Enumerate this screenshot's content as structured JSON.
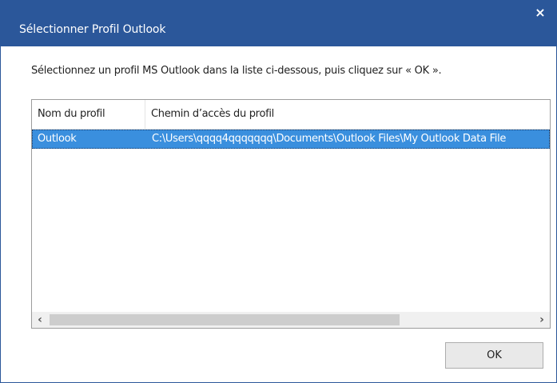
{
  "window": {
    "title": "Sélectionner Profil Outlook",
    "close_symbol": "×",
    "accent_color": "#2b579a"
  },
  "instruction": "Sélectionnez un profil MS Outlook dans la liste ci-dessous, puis cliquez sur « OK ».",
  "profile_list": {
    "columns": [
      "Nom du profil",
      "Chemin d’accès du profil"
    ],
    "rows": [
      {
        "name": "Outlook",
        "path": "C:\\Users\\qqqq4qqqqqqq\\Documents\\Outlook Files\\My Outlook Data File",
        "selected": true
      }
    ],
    "selection_color": "#3a8fde",
    "scroll_left_symbol": "‹",
    "scroll_right_symbol": "›"
  },
  "buttons": {
    "ok": "OK"
  }
}
